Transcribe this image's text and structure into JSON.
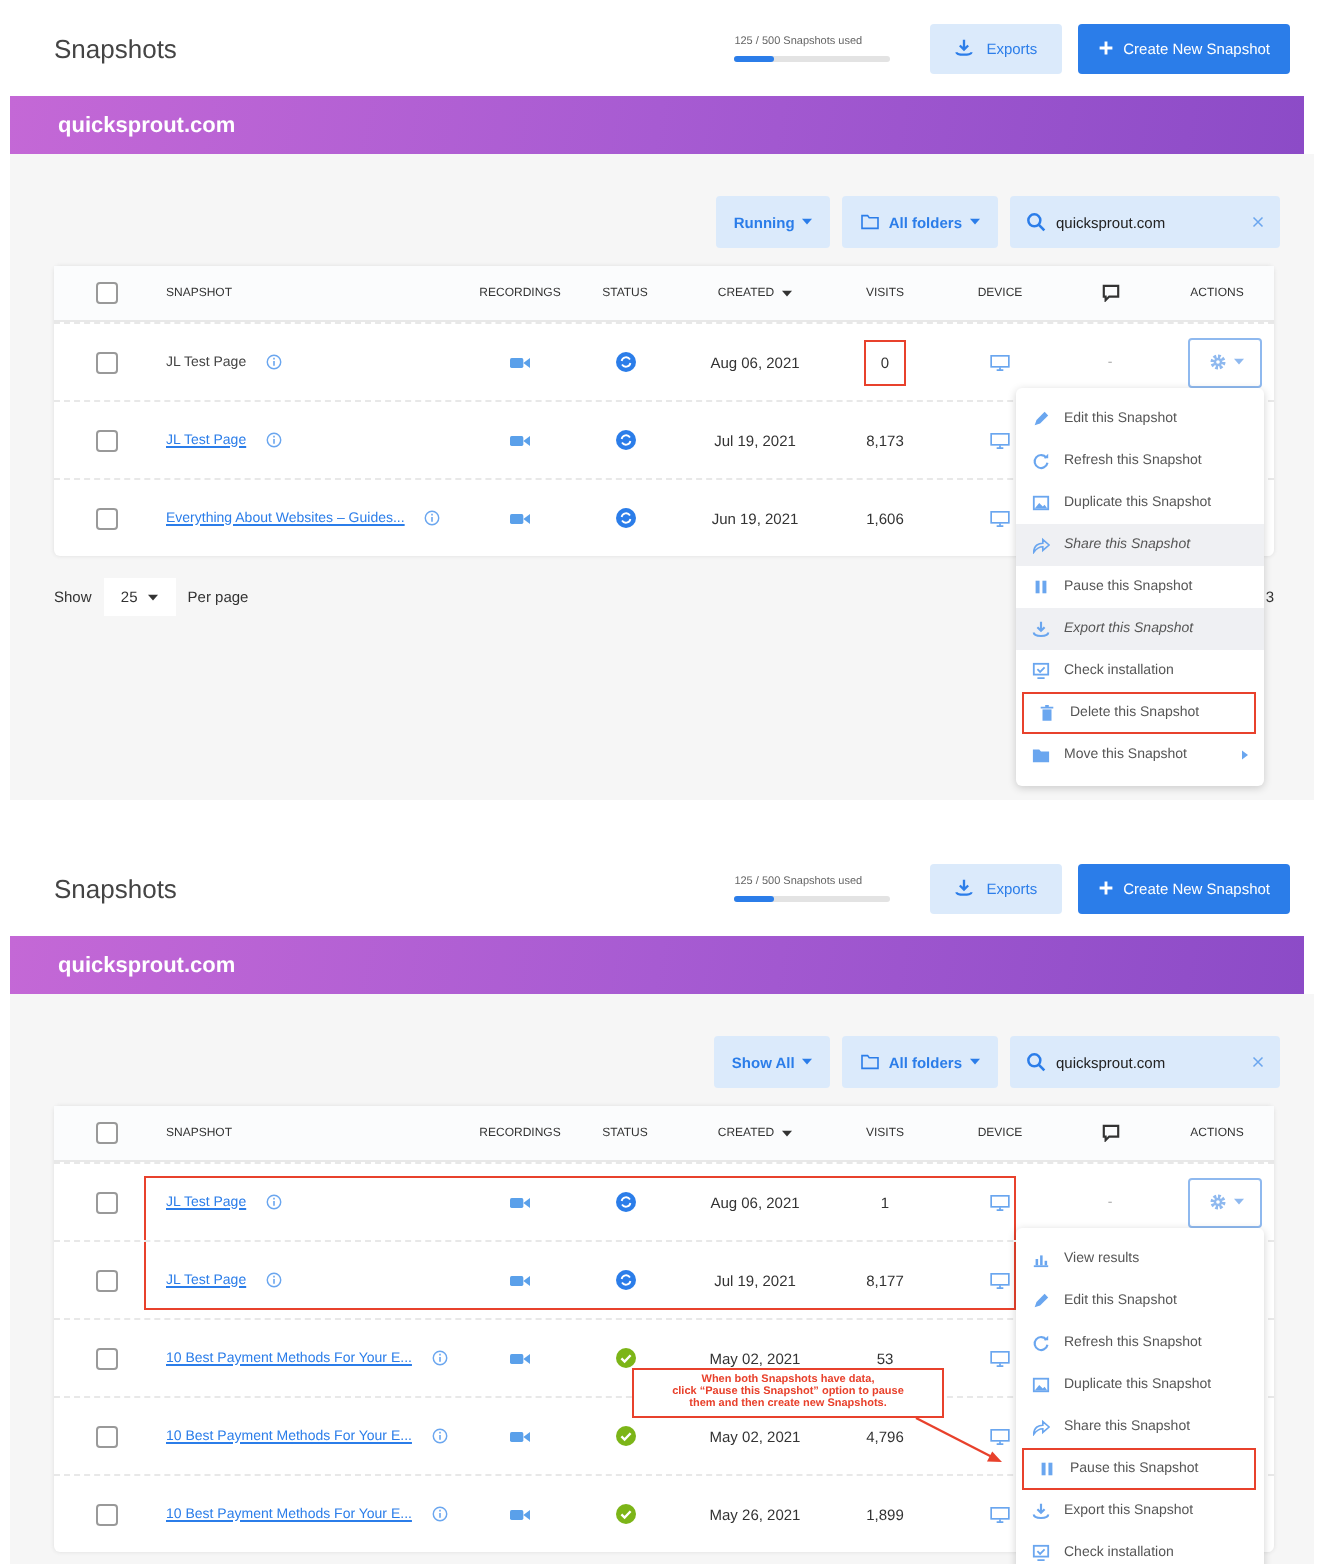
{
  "panels": [
    {
      "title": "Snapshots",
      "usage": "125 / 500 Snapshots used",
      "usage_bar": {
        "level": 0.25
      },
      "exports": "Exports",
      "create": "Create New Snapshot",
      "site": "quicksprout.com",
      "filters": {
        "status": "Running",
        "folders": "All folders",
        "search": "quicksprout.com"
      },
      "header_checked": false,
      "columns": [
        {
          "kind": "text",
          "label": "SNAPSHOT",
          "sorted": false
        },
        {
          "kind": "text",
          "label": "RECORDINGS",
          "sorted": false
        },
        {
          "kind": "text",
          "label": "STATUS",
          "sorted": false
        },
        {
          "kind": "text",
          "label": "CREATED",
          "sorted": true
        },
        {
          "kind": "text",
          "label": "VISITS",
          "sorted": false
        },
        {
          "kind": "text",
          "label": "DEVICE",
          "sorted": false
        },
        {
          "kind": "icon",
          "sorted": false
        },
        {
          "kind": "text",
          "label": "ACTIONS",
          "sorted": false
        }
      ],
      "rows": [
        {
          "checked": false,
          "name": "JL Test Page",
          "link": false,
          "kind": "syncing",
          "created": "Aug 06, 2021",
          "visits": "0",
          "visits_outlined": true,
          "comment": "-",
          "outlined": false,
          "menu_open": true
        },
        {
          "checked": false,
          "name": "JL Test Page",
          "link": true,
          "kind": "syncing",
          "created": "Jul 19, 2021",
          "visits": "8,173",
          "visits_outlined": false,
          "outlined": false,
          "menu_open": false
        },
        {
          "checked": false,
          "name": "Everything About Websites – Guides...",
          "link": true,
          "kind": "syncing",
          "created": "Jun 19, 2021",
          "visits": "1,606",
          "visits_outlined": false,
          "outlined": false,
          "menu_open": false
        }
      ],
      "menu": [
        {
          "kind": "edit",
          "label": "Edit this Snapshot",
          "shaded": false,
          "outlined": false
        },
        {
          "kind": "refresh",
          "label": "Refresh this Snapshot",
          "shaded": false,
          "outlined": false
        },
        {
          "kind": "duplicate",
          "label": "Duplicate this Snapshot",
          "shaded": false,
          "outlined": false
        },
        {
          "kind": "share",
          "label": "Share this Snapshot",
          "shaded": true,
          "outlined": false
        },
        {
          "kind": "pause",
          "label": "Pause this Snapshot",
          "shaded": false,
          "outlined": false
        },
        {
          "kind": "export",
          "label": "Export this Snapshot",
          "shaded": true,
          "outlined": false
        },
        {
          "kind": "check",
          "label": "Check installation",
          "shaded": false,
          "outlined": false
        },
        {
          "kind": "delete",
          "label": "Delete this Snapshot",
          "shaded": false,
          "outlined": true
        },
        {
          "kind": "move",
          "label": "Move this Snapshot",
          "shaded": false,
          "outlined": false,
          "submenu": true
        }
      ],
      "footer": {
        "show": "Show",
        "per_page_value": "25",
        "per_page": "Per page",
        "page": "3"
      }
    },
    {
      "title": "Snapshots",
      "usage": "125 / 500 Snapshots used",
      "usage_bar": {
        "level": 0.25
      },
      "exports": "Exports",
      "create": "Create New Snapshot",
      "site": "quicksprout.com",
      "filters": {
        "status": "Show All",
        "folders": "All folders",
        "search": "quicksprout.com"
      },
      "header_checked": false,
      "columns": [
        {
          "kind": "text",
          "label": "SNAPSHOT",
          "sorted": false
        },
        {
          "kind": "text",
          "label": "RECORDINGS",
          "sorted": false
        },
        {
          "kind": "text",
          "label": "STATUS",
          "sorted": false
        },
        {
          "kind": "text",
          "label": "CREATED",
          "sorted": true
        },
        {
          "kind": "text",
          "label": "VISITS",
          "sorted": false
        },
        {
          "kind": "text",
          "label": "DEVICE",
          "sorted": false
        },
        {
          "kind": "icon",
          "sorted": false
        },
        {
          "kind": "text",
          "label": "ACTIONS",
          "sorted": false
        }
      ],
      "rows": [
        {
          "checked": false,
          "name": "JL Test Page",
          "link": true,
          "kind": "syncing",
          "created": "Aug 06, 2021",
          "visits": "1",
          "visits_outlined": false,
          "comment": "-",
          "outlined": true,
          "menu_open": true
        },
        {
          "checked": false,
          "name": "JL Test Page",
          "link": true,
          "kind": "syncing",
          "created": "Jul 19, 2021",
          "visits": "8,177",
          "visits_outlined": false,
          "outlined": true,
          "menu_open": false
        },
        {
          "checked": false,
          "name": "10 Best Payment Methods For Your E...",
          "link": true,
          "kind": "done",
          "created": "May 02, 2021",
          "visits": "53",
          "visits_outlined": false,
          "outlined": false,
          "menu_open": false
        },
        {
          "checked": false,
          "name": "10 Best Payment Methods For Your E...",
          "link": true,
          "kind": "done",
          "created": "May 02, 2021",
          "visits": "4,796",
          "visits_outlined": false,
          "outlined": false,
          "menu_open": false
        },
        {
          "checked": false,
          "name": "10 Best Payment Methods For Your E...",
          "link": true,
          "kind": "done",
          "created": "May 26, 2021",
          "visits": "1,899",
          "visits_outlined": false,
          "outlined": false,
          "menu_open": false
        }
      ],
      "menu": [
        {
          "kind": "results",
          "label": "View results",
          "shaded": false,
          "outlined": false
        },
        {
          "kind": "edit",
          "label": "Edit this Snapshot",
          "shaded": false,
          "outlined": false
        },
        {
          "kind": "refresh",
          "label": "Refresh this Snapshot",
          "shaded": false,
          "outlined": false
        },
        {
          "kind": "duplicate",
          "label": "Duplicate this Snapshot",
          "shaded": false,
          "outlined": false
        },
        {
          "kind": "share",
          "label": "Share this Snapshot",
          "shaded": false,
          "outlined": false
        },
        {
          "kind": "pause",
          "label": "Pause this Snapshot",
          "shaded": false,
          "outlined": true
        },
        {
          "kind": "export",
          "label": "Export this Snapshot",
          "shaded": false,
          "outlined": false
        },
        {
          "kind": "check",
          "label": "Check installation",
          "shaded": false,
          "outlined": false
        }
      ],
      "callout": {
        "lines": [
          "When both Snapshots have data,",
          "click “Pause this Snapshot” option to pause",
          "them and then create new Snapshots."
        ]
      }
    }
  ]
}
